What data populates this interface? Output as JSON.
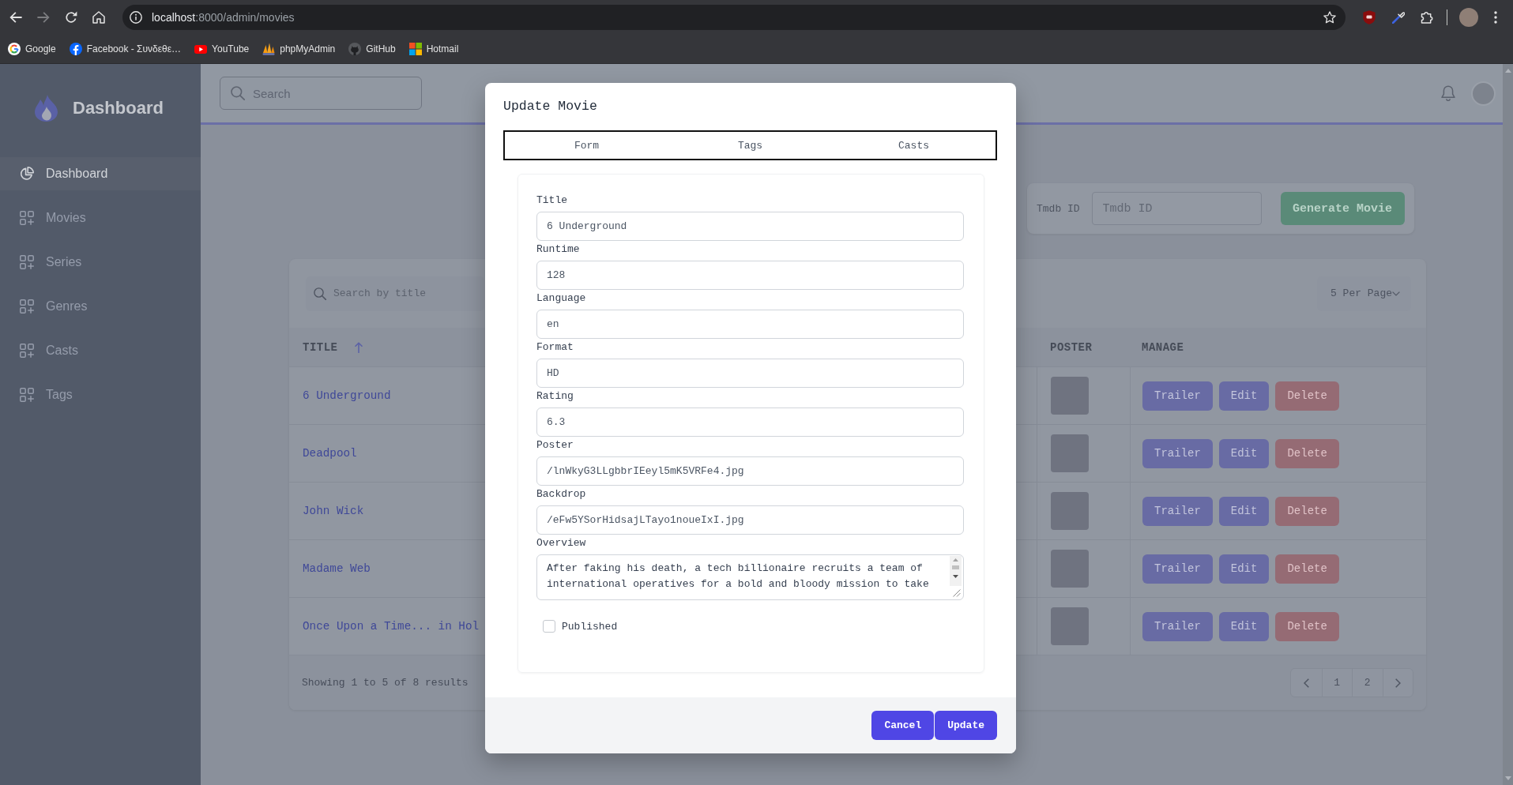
{
  "browser": {
    "url": {
      "host": "localhost",
      "path": ":8000/admin/movies"
    },
    "bookmarks": [
      {
        "label": "Google"
      },
      {
        "label": "Facebook - Συνδεθε…"
      },
      {
        "label": "YouTube"
      },
      {
        "label": "phpMyAdmin"
      },
      {
        "label": "GitHub"
      },
      {
        "label": "Hotmail"
      }
    ]
  },
  "sidebar": {
    "brand": "Dashboard",
    "items": [
      {
        "label": "Dashboard",
        "selected": true
      },
      {
        "label": "Movies",
        "selected": false
      },
      {
        "label": "Series",
        "selected": false
      },
      {
        "label": "Genres",
        "selected": false
      },
      {
        "label": "Casts",
        "selected": false
      },
      {
        "label": "Tags",
        "selected": false
      }
    ]
  },
  "header": {
    "search": {
      "placeholder": "Search"
    }
  },
  "tmdb": {
    "label": "Tmdb ID",
    "input": {
      "placeholder": "Tmdb ID"
    },
    "button": "Generate Movie"
  },
  "table": {
    "search": {
      "placeholder": "Search by title"
    },
    "per_page": "5 Per Page",
    "columns": [
      {
        "label": "TITLE",
        "sorted": true
      },
      {
        "label": "POSTER",
        "sorted": false
      },
      {
        "label": "MANAGE",
        "sorted": false
      }
    ],
    "rows": [
      {
        "title": "6 Underground",
        "actions": [
          {
            "label": "Trailer",
            "kind": "primary"
          },
          {
            "label": "Edit",
            "kind": "primary"
          },
          {
            "label": "Delete",
            "kind": "danger"
          }
        ]
      },
      {
        "title": "Deadpool",
        "actions": [
          {
            "label": "Trailer",
            "kind": "primary"
          },
          {
            "label": "Edit",
            "kind": "primary"
          },
          {
            "label": "Delete",
            "kind": "danger"
          }
        ]
      },
      {
        "title": "John Wick",
        "actions": [
          {
            "label": "Trailer",
            "kind": "primary"
          },
          {
            "label": "Edit",
            "kind": "primary"
          },
          {
            "label": "Delete",
            "kind": "danger"
          }
        ]
      },
      {
        "title": "Madame Web",
        "actions": [
          {
            "label": "Trailer",
            "kind": "primary"
          },
          {
            "label": "Edit",
            "kind": "primary"
          },
          {
            "label": "Delete",
            "kind": "danger"
          }
        ]
      },
      {
        "title": "Once Upon a Time... in Hol",
        "actions": [
          {
            "label": "Trailer",
            "kind": "primary"
          },
          {
            "label": "Edit",
            "kind": "primary"
          },
          {
            "label": "Delete",
            "kind": "danger"
          }
        ]
      }
    ],
    "summary": "Showing 1 to 5 of 8 results",
    "pages": [
      "1",
      "2"
    ]
  },
  "modal": {
    "title": "Update Movie",
    "tabs": [
      {
        "label": "Form"
      },
      {
        "label": "Tags"
      },
      {
        "label": "Casts"
      }
    ],
    "fields": [
      {
        "label": "Title",
        "value": "6 Underground",
        "kind": "text"
      },
      {
        "label": "Runtime",
        "value": "128",
        "kind": "text"
      },
      {
        "label": "Language",
        "value": "en",
        "kind": "text"
      },
      {
        "label": "Format",
        "value": "HD",
        "kind": "text"
      },
      {
        "label": "Rating",
        "value": "6.3",
        "kind": "text"
      },
      {
        "label": "Poster",
        "value": "/lnWkyG3LLgbbrIEeyl5mK5VRFe4.jpg",
        "kind": "text"
      },
      {
        "label": "Backdrop",
        "value": "/eFw5YSorHidsajLTayo1noueIxI.jpg",
        "kind": "text"
      },
      {
        "label": "Overview",
        "value": "After faking his death, a tech billionaire recruits a team of international operatives for a bold and bloody mission to take",
        "kind": "textarea"
      }
    ],
    "published": {
      "label": "Published",
      "checked": false
    },
    "buttons": [
      {
        "label": "Cancel"
      },
      {
        "label": "Update"
      }
    ]
  }
}
